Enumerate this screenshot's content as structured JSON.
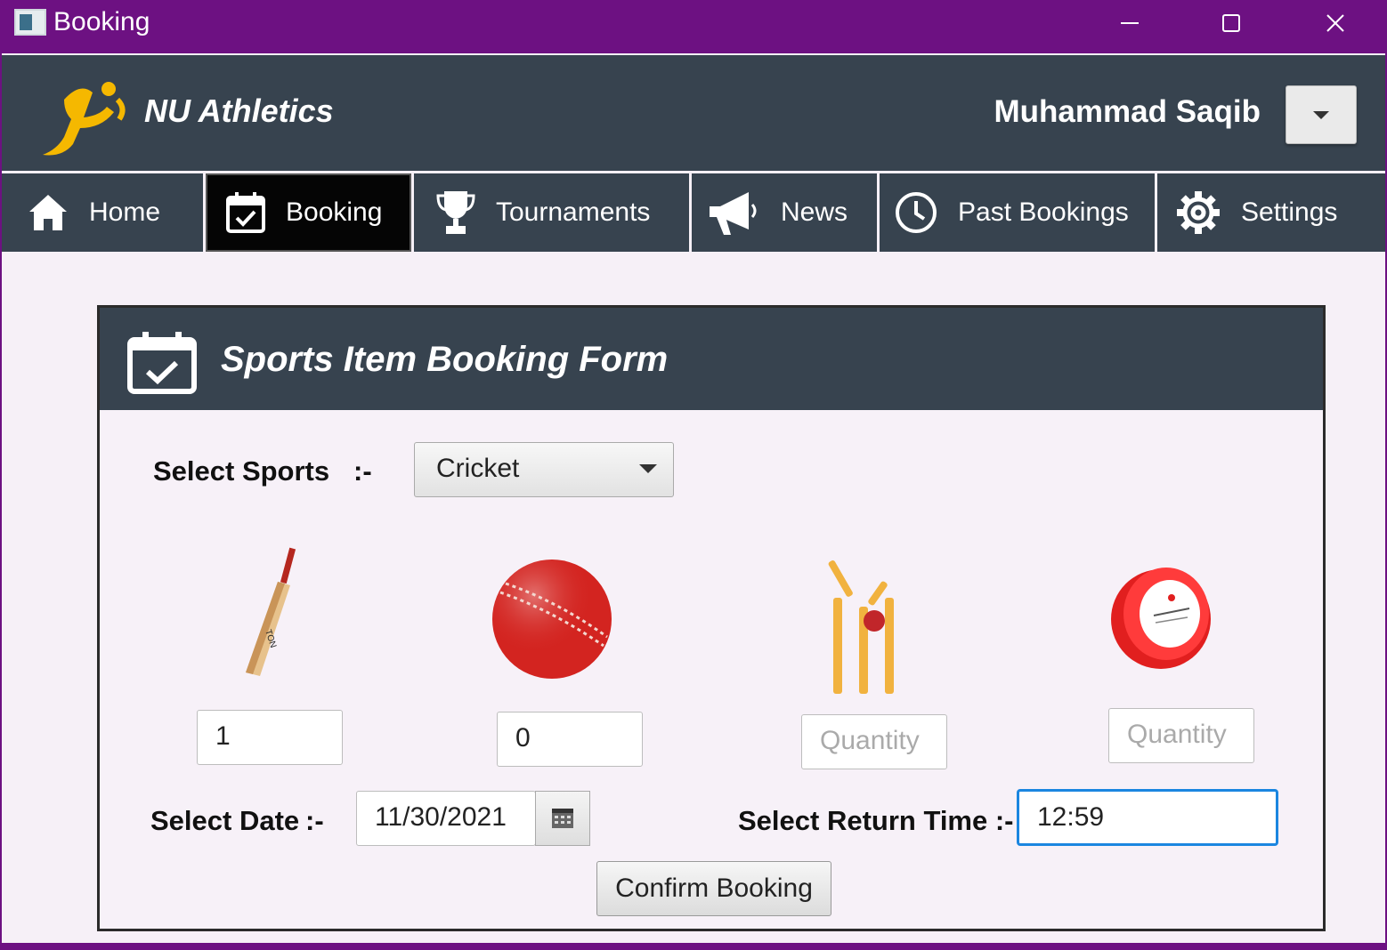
{
  "window": {
    "title": "Booking",
    "minimize_icon": "minimize-icon",
    "maximize_icon": "maximize-icon",
    "close_icon": "close-icon"
  },
  "header": {
    "brand": "NU Athletics",
    "user_name": "Muhammad Saqib"
  },
  "nav": {
    "items": [
      {
        "label": "Home",
        "icon": "home-icon"
      },
      {
        "label": "Booking",
        "icon": "calendar-check-icon",
        "active": true
      },
      {
        "label": "Tournaments",
        "icon": "trophy-icon"
      },
      {
        "label": "News",
        "icon": "megaphone-icon"
      },
      {
        "label": "Past Bookings",
        "icon": "clock-icon"
      },
      {
        "label": "Settings",
        "icon": "gear-icon"
      }
    ]
  },
  "form": {
    "title": "Sports Item Booking Form",
    "sports_label": "Select Sports",
    "sports_sep": ":-",
    "sports_value": "Cricket",
    "items": [
      {
        "icon": "cricket-bat-image",
        "quantity": "1",
        "placeholder": "Quantity"
      },
      {
        "icon": "cricket-ball-image",
        "quantity": "0",
        "placeholder": "Quantity"
      },
      {
        "icon": "cricket-stumps-image",
        "quantity": "",
        "placeholder": "Quantity"
      },
      {
        "icon": "tape-roll-image",
        "quantity": "",
        "placeholder": "Quantity"
      }
    ],
    "date_label": "Select Date",
    "date_sep": ":-",
    "date_value": "11/30/2021",
    "return_time_label": "Select Return Time :-",
    "return_time_value": "12:59",
    "confirm_label": "Confirm Booking"
  },
  "colors": {
    "titlebar": "#6d1182",
    "header": "#37434f",
    "active_tab": "#050505",
    "focus": "#1b86e0",
    "logo": "#f5b800"
  }
}
